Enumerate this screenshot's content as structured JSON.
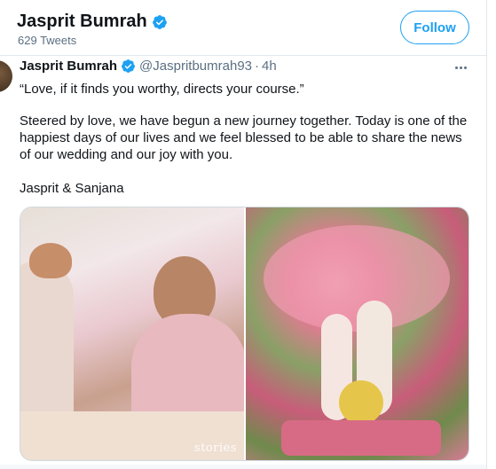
{
  "profile": {
    "name": "Jasprit Bumrah",
    "tweet_count": "629 Tweets",
    "follow_label": "Follow"
  },
  "tweet": {
    "author_name": "Jasprit Bumrah",
    "handle": "@Jaspritbumrah93",
    "separator": "·",
    "time": "4h",
    "quote": "“Love, if it finds you worthy, directs your course.”",
    "body": "Steered by love, we have begun a new journey together. Today is one of the happiest days of our lives and we feel blessed to be able to share the news of our wedding and our joy with you.",
    "signoff": "Jasprit & Sanjana",
    "photo_watermark": "stories"
  },
  "colors": {
    "accent": "#1da1f2",
    "muted": "#5b7083",
    "text": "#0f1419"
  }
}
